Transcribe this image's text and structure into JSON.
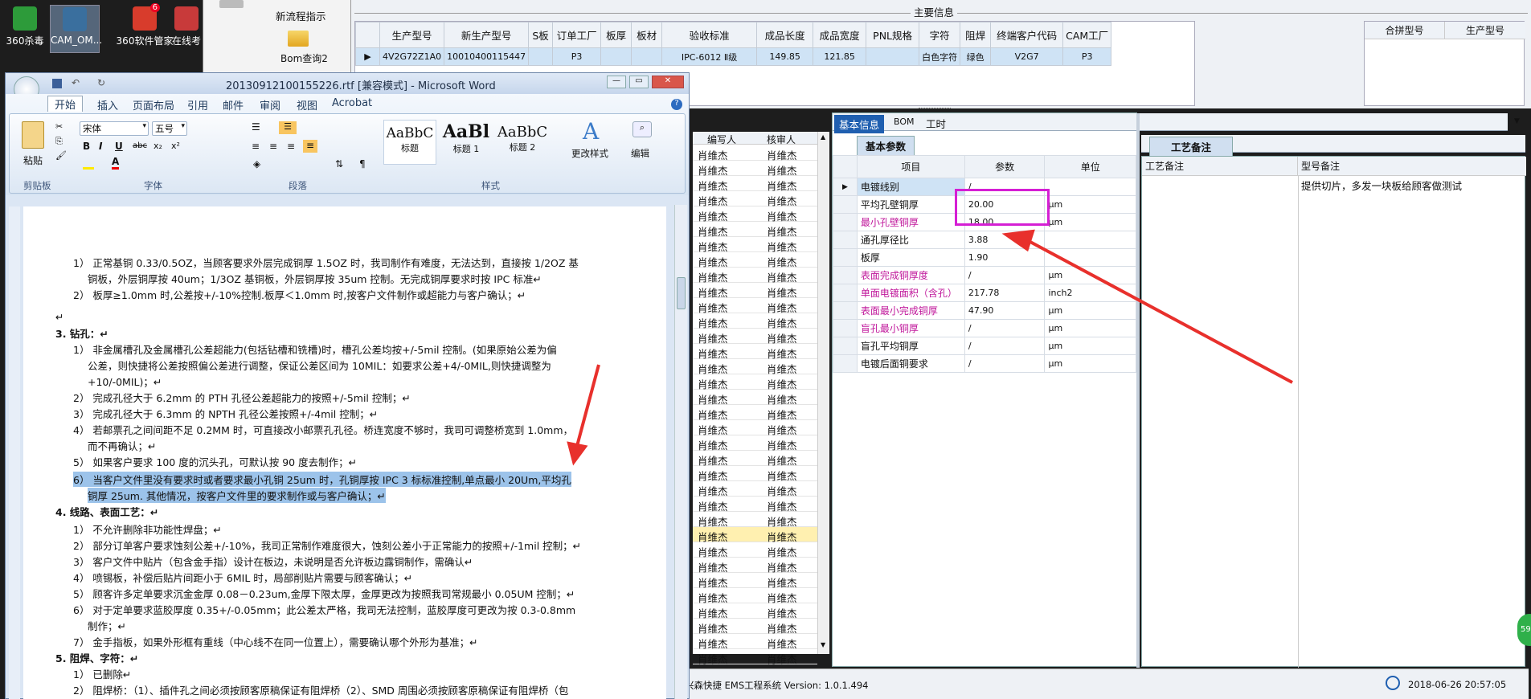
{
  "desktop": {
    "icons": [
      {
        "label": "360杀毒",
        "icon": "shield-icon",
        "color": "#2d9b3a"
      },
      {
        "label": "CAM_OM...",
        "icon": "app-icon",
        "color": "#3a6f9e"
      },
      {
        "label": "360软件管家",
        "icon": "grid-icon",
        "color": "#d83c2c",
        "badge": "6"
      },
      {
        "label": "在线考",
        "icon": "app-icon",
        "color": "#c83a3a"
      }
    ]
  },
  "left_panel": {
    "flow_label": "新流程指示",
    "bom_label": "Bom查询2"
  },
  "main_info": {
    "title": "主要信息",
    "columns": [
      "生产型号",
      "新生产型号",
      "S板",
      "订单工厂",
      "板厚",
      "板材",
      "验收标准",
      "成品长度",
      "成品宽度",
      "PNL规格",
      "字符",
      "阻焊",
      "终端客户代码",
      "CAM工厂"
    ],
    "row": [
      "4V2G72Z1A0",
      "10010400115447",
      "",
      "P3",
      "",
      "",
      "IPC-6012 Ⅱ级",
      "149.85",
      "121.85",
      "",
      "白色字符",
      "绿色",
      "V2G7",
      "P3"
    ],
    "right_columns": [
      "合拼型号",
      "生产型号"
    ]
  },
  "list": {
    "headers": [
      "编写人",
      "核审人"
    ],
    "name": "肖维杰",
    "selected_index": 25,
    "row_count": 34
  },
  "param_tabs": [
    "基本信息",
    "BOM",
    "工时"
  ],
  "params": {
    "section_title": "基本参数",
    "headers": [
      "项目",
      "参数",
      "单位"
    ],
    "rows": [
      {
        "item": "电镀线别",
        "value": "/",
        "unit": "",
        "pink": false
      },
      {
        "item": "平均孔壁铜厚",
        "value": "20.00",
        "unit": "μm",
        "pink": false
      },
      {
        "item": "最小孔壁铜厚",
        "value": "18.00",
        "unit": "μm",
        "pink": true
      },
      {
        "item": "通孔厚径比",
        "value": "3.88",
        "unit": "",
        "pink": false
      },
      {
        "item": "板厚",
        "value": "1.90",
        "unit": "",
        "pink": false
      },
      {
        "item": "表面完成铜厚度",
        "value": "/",
        "unit": "μm",
        "pink": true
      },
      {
        "item": "单面电镀面积（含孔）",
        "value": "217.78",
        "unit": "inch2",
        "pink": true
      },
      {
        "item": "表面最小完成铜厚",
        "value": "47.90",
        "unit": "μm",
        "pink": true
      },
      {
        "item": "盲孔最小铜厚",
        "value": "/",
        "unit": "μm",
        "pink": true
      },
      {
        "item": "盲孔平均铜厚",
        "value": "/",
        "unit": "μm",
        "pink": false
      },
      {
        "item": "电镀后面铜要求",
        "value": "/",
        "unit": "μm",
        "pink": false
      }
    ]
  },
  "craft": {
    "tab": "工艺备注",
    "col1": "工艺备注",
    "col2": "型号备注",
    "note": "提供切片，多发一块板给顾客做测试"
  },
  "status_bar": {
    "app": "兴森快捷 EMS工程系统 Version: 1.0.1.494",
    "datetime": "2018-06-26 20:57:05"
  },
  "word": {
    "title": "20130912100155226.rtf [兼容模式] - Microsoft Word",
    "tabs": [
      "开始",
      "插入",
      "页面布局",
      "引用",
      "邮件",
      "审阅",
      "视图",
      "Acrobat"
    ],
    "font_name": "宋体",
    "font_size": "五号",
    "groups": [
      "剪贴板",
      "字体",
      "段落",
      "样式"
    ],
    "paste": "粘贴",
    "styles": [
      {
        "preview": "AaBbC",
        "name": "标题"
      },
      {
        "preview": "AaBl",
        "name": "标题 1"
      },
      {
        "preview": "AaBbC",
        "name": "标题 2"
      }
    ],
    "change_style": "更改样式",
    "edit": "编辑",
    "lines": [
      {
        "t": "1） 正常基铜 0.33/0.5OZ，当顾客要求外层完成铜厚 1.5OZ 时，我司制作有难度，无法达到，直接按 1/2OZ 基",
        "x": 62
      },
      {
        "t": "铜板，外层铜厚按 40um；1/3OZ 基铜板，外层铜厚按 35um 控制。无完成铜厚要求时按 IPC 标准↵",
        "x": 80
      },
      {
        "t": "2） 板厚≥1.0mm 时,公差按+/-10%控制.板厚＜1.0mm 时,按客户文件制作或超能力与客户确认；↵",
        "x": 62
      },
      {
        "t": "↵",
        "x": 40
      },
      {
        "t": "3.   钻孔：↵",
        "x": 40,
        "bold": true
      },
      {
        "t": "1） 非金属槽孔及金属槽孔公差超能力(包括钻槽和铣槽)时，槽孔公差均按+/-5mil 控制。(如果原始公差为偏",
        "x": 62
      },
      {
        "t": "公差，则快捷将公差按照偏公差进行调整，保证公差区间为 10MIL：如要求公差+4/-0MIL,则快捷调整为",
        "x": 80
      },
      {
        "t": "+10/-0MIL)；↵",
        "x": 80
      },
      {
        "t": "2） 完成孔径大于 6.2mm 的 PTH 孔径公差超能力的按照+/-5mil 控制；↵",
        "x": 62
      },
      {
        "t": "3） 完成孔径大于 6.3mm 的 NPTH 孔径公差按照+/-4mil 控制；↵",
        "x": 62
      },
      {
        "t": "4） 若邮票孔之间间距不足 0.2MM 时，可直接改小邮票孔孔径。桥连宽度不够时，我司可调整桥宽到 1.0mm，",
        "x": 62
      },
      {
        "t": "而不再确认；↵",
        "x": 80
      },
      {
        "t": "5） 如果客户要求 100 度的沉头孔，可默认按 90 度去制作；↵",
        "x": 62
      },
      {
        "t": "6） 当客户文件里没有要求时或者要求最小孔铜 25um 时，孔铜厚按 IPC 3 标标准控制,单点最小 20Um,平均孔",
        "x": 62,
        "hl": true
      },
      {
        "t": "铜厚 25um. 其他情况，按客户文件里的要求制作或与客户确认；↵",
        "x": 80,
        "hl": true
      },
      {
        "t": "4.   线路、表面工艺：↵",
        "x": 40,
        "bold": true
      },
      {
        "t": "1） 不允许删除非功能性焊盘；↵",
        "x": 62
      },
      {
        "t": "2） 部分订单客户要求蚀刻公差+/-10%，我司正常制作难度很大，蚀刻公差小于正常能力的按照+/-1mil 控制；↵",
        "x": 62
      },
      {
        "t": "3） 客户文件中贴片（包含金手指）设计在板边，未说明是否允许板边露铜制作，需确认↵",
        "x": 62
      },
      {
        "t": "4） 喷锡板，补偿后贴片间距小于 6MIL 时，局部削贴片需要与顾客确认；↵",
        "x": 62
      },
      {
        "t": "5） 顾客许多定单要求沉金金厚 0.08－0.23um,金厚下限太厚，金厚更改为按照我司常规最小 0.05UM 控制；↵",
        "x": 62
      },
      {
        "t": "6） 对于定单要求蓝胶厚度 0.35+/-0.05mm；此公差太严格，我司无法控制，蓝胶厚度可更改为按 0.3-0.8mm",
        "x": 62
      },
      {
        "t": "制作；↵",
        "x": 80
      },
      {
        "t": "7） 金手指板，如果外形框有重线（中心线不在同一位置上），需要确认哪个外形为基准；↵",
        "x": 62
      },
      {
        "t": "5.   阻焊、字符：↵",
        "x": 40,
        "bold": true
      },
      {
        "t": "1） 已删除↵",
        "x": 62
      },
      {
        "t": "2） 阻焊桥：（1）、插件孔之间必须按顾客原稿保证有阻焊桥（2）、SMD 周围必须按顾客原稿保证有阻焊桥（包",
        "x": 62
      }
    ]
  },
  "colors": {
    "accent": "#1f5fb0",
    "highlight": "#9cc3ea",
    "pink": "#c0179b",
    "box": "#d51fd4",
    "arrow": "#e8302c",
    "selected_row": "#fff0b0"
  },
  "badge_right": "59"
}
